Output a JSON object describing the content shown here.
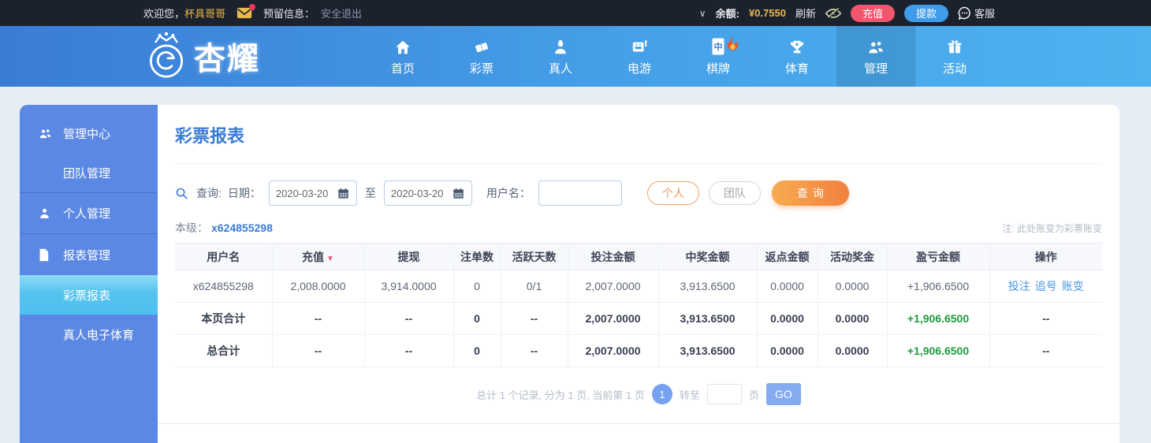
{
  "topbar": {
    "welcome_prefix": "欢迎您，",
    "username": "杯具哥哥",
    "reserved_label": "预留信息：",
    "logout": "安全退出",
    "balance_label": "余额:",
    "balance_value": "¥0.7550",
    "refresh": "刷新",
    "deposit_button": "充值",
    "withdraw_button": "提款",
    "service": "客服"
  },
  "icons": {
    "chevron_down": "∨",
    "sort_desc": "▼"
  },
  "nav": {
    "logo_text": "杏耀",
    "items": [
      {
        "label": "首页",
        "icon": "home-icon",
        "active": false
      },
      {
        "label": "彩票",
        "icon": "ticket-icon",
        "active": false
      },
      {
        "label": "真人",
        "icon": "person-icon",
        "active": false
      },
      {
        "label": "电游",
        "icon": "slot-machine-icon",
        "active": false
      },
      {
        "label": "棋牌",
        "icon": "mahjong-icon",
        "badge": "flame-icon",
        "active": false
      },
      {
        "label": "体育",
        "icon": "trophy-icon",
        "active": false
      },
      {
        "label": "管理",
        "icon": "users-icon",
        "active": true
      },
      {
        "label": "活动",
        "icon": "gift-icon",
        "active": false
      }
    ]
  },
  "sidebar": {
    "items": [
      {
        "label": "管理中心",
        "icon": "users-icon",
        "type": "section",
        "active": false
      },
      {
        "label": "团队管理",
        "type": "sub",
        "active": false
      },
      {
        "label": "个人管理",
        "icon": "user-icon",
        "type": "section",
        "active": false
      },
      {
        "label": "报表管理",
        "icon": "document-icon",
        "type": "section",
        "active": false
      },
      {
        "label": "彩票报表",
        "type": "sub",
        "active": true
      },
      {
        "label": "真人电子体育",
        "type": "sub",
        "active": false
      }
    ]
  },
  "main": {
    "title": "彩票报表",
    "search": {
      "query_label": "查询:",
      "date_label": "日期：",
      "date_from": "2020-03-20",
      "to_label": "至",
      "date_to": "2020-03-20",
      "username_label": "用户名：",
      "username_value": "",
      "personal_button": "个人",
      "team_button": "团队",
      "search_button": "查询"
    },
    "level_label": "本级：",
    "level_value": "x624855298",
    "note": "注: 此处账变为彩票账变",
    "table": {
      "headers": [
        "用户名",
        "充值",
        "提现",
        "注单数",
        "活跃天数",
        "投注金额",
        "中奖金额",
        "返点金额",
        "活动奖金",
        "盈亏金额",
        "操作"
      ],
      "sorted_column": "充值",
      "rows": [
        {
          "cells": [
            "x624855298",
            "2,008.0000",
            "3,914.0000",
            "0",
            "0/1",
            "2,007.0000",
            "3,913.6500",
            "0.0000",
            "0.0000",
            "+1,906.6500"
          ],
          "actions": [
            "投注",
            "追号",
            "账变"
          ]
        },
        {
          "cells": [
            "本页合计",
            "--",
            "--",
            "0",
            "--",
            "2,007.0000",
            "3,913.6500",
            "0.0000",
            "0.0000",
            "+1,906.6500"
          ],
          "ops": "--"
        },
        {
          "cells": [
            "总合计",
            "--",
            "--",
            "0",
            "--",
            "2,007.0000",
            "3,913.6500",
            "0.0000",
            "0.0000",
            "+1,906.6500"
          ],
          "ops": "--"
        }
      ]
    },
    "pagination": {
      "summary": "总计 1 个记录, 分为 1 页, 当前第 1 页",
      "current_page": "1",
      "goto_label": "转至",
      "page_unit": "页",
      "go_button": "GO"
    }
  },
  "colors": {
    "topbar_bg": "#1c212e",
    "gold": "#e9b74a",
    "nav_blue": "#45a0e8",
    "sidebar_blue": "#5b88e4",
    "sidebar_active": "#55c3ef",
    "title_blue": "#3a7bd5",
    "accent_orange": "#f2813e",
    "sort_red": "#f0566d",
    "profit_green": "#27a845",
    "link_blue": "#4a97e8"
  }
}
